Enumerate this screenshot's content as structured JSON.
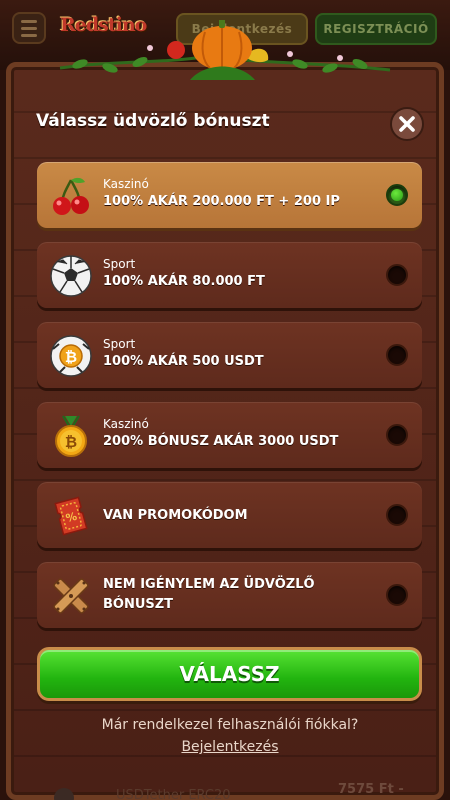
{
  "header": {
    "logo_text": "Redstino",
    "login_label": "Bejelentkezés",
    "register_label": "REGISZTRÁCIÓ"
  },
  "modal": {
    "title": "Válassz üdvözlő bónuszt",
    "close_icon": "close-icon",
    "options": [
      {
        "category": "Kaszinó",
        "title": "100% AKÁR 200.000 FT + 200 IP",
        "icon": "cherries-icon",
        "selected": true
      },
      {
        "category": "Sport",
        "title": "100% AKÁR 80.000 FT",
        "icon": "soccer-ball-icon",
        "selected": false
      },
      {
        "category": "Sport",
        "title": "100% AKÁR 500 USDT",
        "icon": "bitcoin-ball-icon",
        "selected": false
      },
      {
        "category": "Kaszinó",
        "title": "200% BÓNUSZ AKÁR 3000 USDT",
        "icon": "bitcoin-medal-icon",
        "selected": false
      },
      {
        "category": "",
        "title": "VAN PROMOKÓDOM",
        "icon": "promo-ticket-icon",
        "selected": false
      },
      {
        "category": "",
        "title_line1": "NEM IGÉNYLEM AZ ÜDVÖZLŐ",
        "title_line2": "BÓNUSZT",
        "icon": "crossed-planks-icon",
        "selected": false
      }
    ],
    "choose_label": "VÁLASSZ",
    "footer_question": "Már rendelkezel felhasználói fiókkal?",
    "footer_link": "Bejelentkezés"
  },
  "ticker": {
    "left_text": "USDTether ERC20",
    "right_text": "7575 Ft -"
  },
  "colors": {
    "selected_option": "#c98a46",
    "option_bg": "#6e3322",
    "accent_green": "#22b40f",
    "modal_bg": "#4a2016"
  }
}
